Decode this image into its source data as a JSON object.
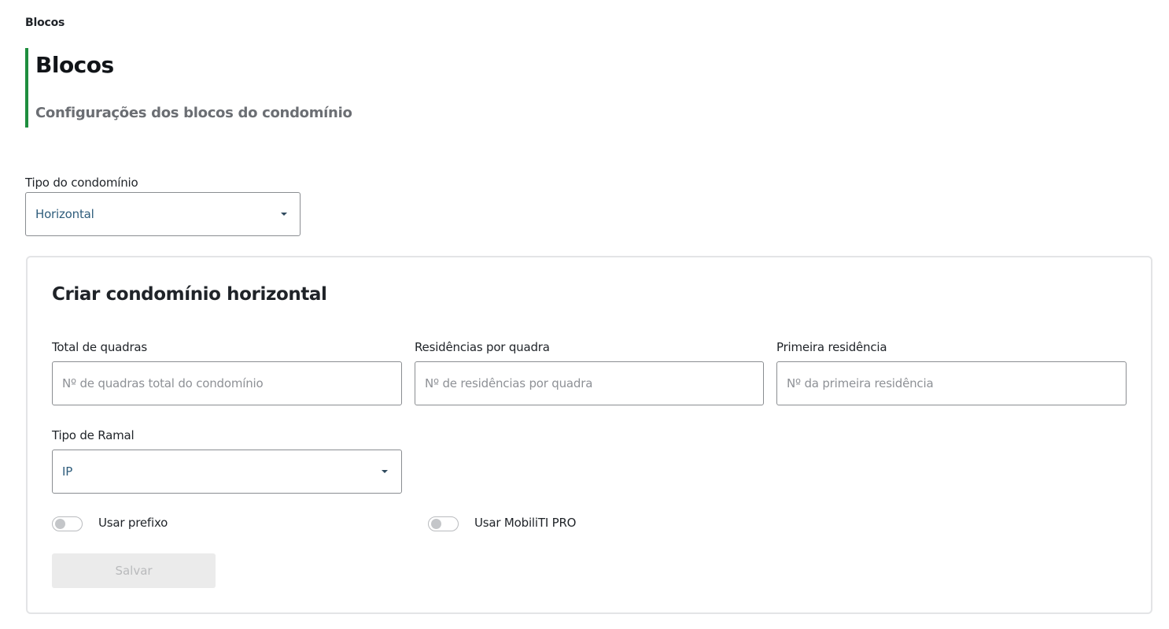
{
  "breadcrumb": {
    "current": "Blocos"
  },
  "header": {
    "title": "Blocos",
    "subtitle": "Configurações dos blocos do condomínio",
    "accent_color": "#1e8e3e"
  },
  "condo_type": {
    "label": "Tipo do condomínio",
    "selected": "Horizontal"
  },
  "form": {
    "title": "Criar condomínio horizontal",
    "total_blocks": {
      "label": "Total de quadras",
      "placeholder": "Nº de quadras total do condomínio",
      "value": ""
    },
    "residences_per_block": {
      "label": "Residências por quadra",
      "placeholder": "Nº de residências por quadra",
      "value": ""
    },
    "first_residence": {
      "label": "Primeira residência",
      "placeholder": "Nº da primeira residência",
      "value": ""
    },
    "extension_type": {
      "label": "Tipo de Ramal",
      "selected": "IP"
    },
    "use_prefix": {
      "label": "Usar prefixo",
      "enabled": false
    },
    "use_mobiliti_pro": {
      "label": "Usar MobiliTI PRO",
      "enabled": false
    },
    "save_label": "Salvar",
    "save_disabled": true
  }
}
